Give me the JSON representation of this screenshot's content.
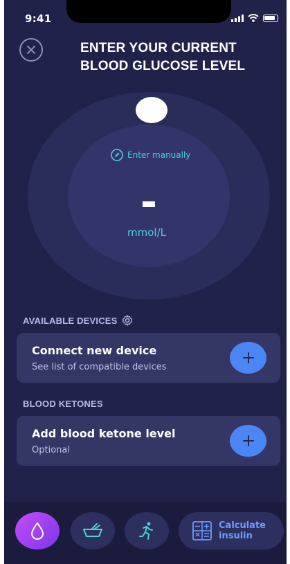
{
  "status_bar": {
    "time": "9:41"
  },
  "header": {
    "title": "ENTER YOUR CURRENT BLOOD GLUCOSE LEVEL"
  },
  "glucose_input": {
    "enter_manually_label": "Enter manually",
    "value": "-",
    "unit": "mmol/L"
  },
  "devices": {
    "section_label": "AVAILABLE DEVICES",
    "card_title": "Connect new device",
    "card_subtitle": "See list of compatible devices"
  },
  "ketones": {
    "section_label": "BLOOD KETONES",
    "card_title": "Add blood ketone level",
    "card_subtitle": "Optional"
  },
  "bottom_nav": {
    "calculate_label": "Calculate insulin"
  },
  "colors": {
    "background": "#21224a",
    "accent_cyan": "#4fd1d9",
    "accent_blue": "#4c85f6",
    "active_purple": "#b042f5"
  },
  "icons": {
    "close": "close-icon",
    "edit": "pencil-icon",
    "settings": "gear-icon",
    "add": "plus-icon",
    "glucose": "drop-icon",
    "meal": "bowl-icon",
    "activity": "running-icon",
    "calculator": "calculator-icon"
  }
}
